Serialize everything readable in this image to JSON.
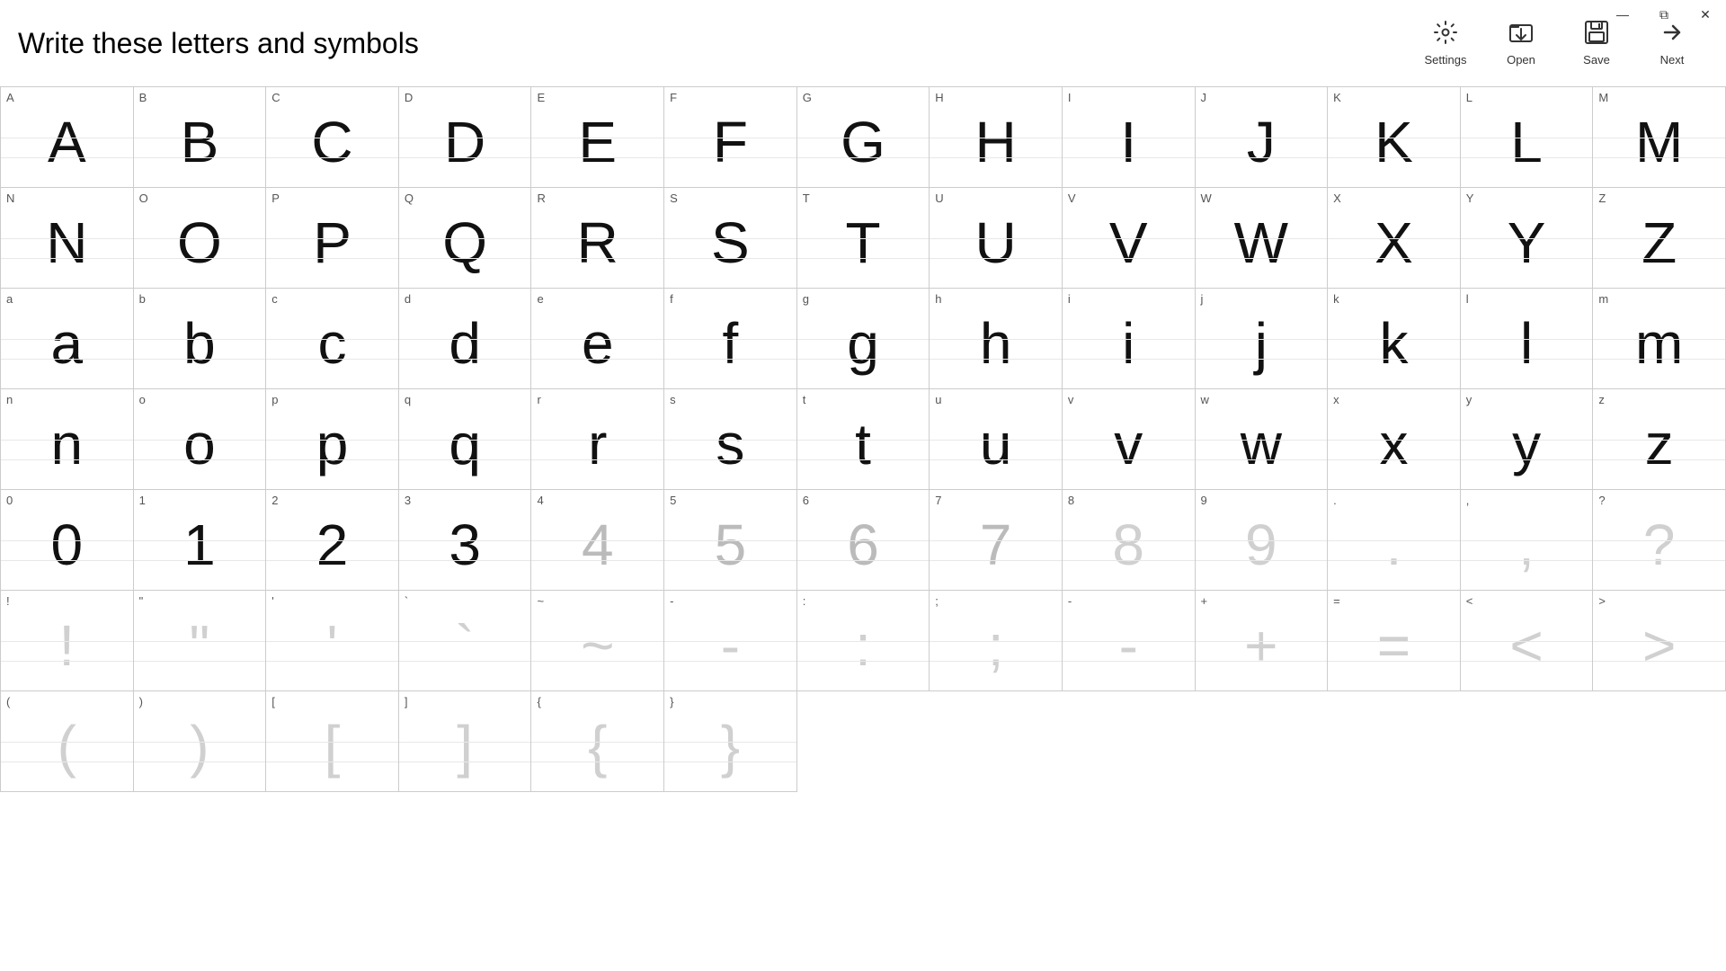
{
  "title": "Write these letters and symbols",
  "toolbar": {
    "settings_label": "Settings",
    "open_label": "Open",
    "save_label": "Save",
    "next_label": "Next"
  },
  "titlebar": {
    "minimize": "—",
    "maximize": "❐",
    "close": "✕"
  },
  "cells": [
    {
      "label": "A",
      "char": "A",
      "style": "handwritten"
    },
    {
      "label": "B",
      "char": "B",
      "style": "handwritten"
    },
    {
      "label": "C",
      "char": "C",
      "style": "handwritten"
    },
    {
      "label": "D",
      "char": "D",
      "style": "handwritten"
    },
    {
      "label": "E",
      "char": "E",
      "style": "handwritten"
    },
    {
      "label": "F",
      "char": "F",
      "style": "handwritten"
    },
    {
      "label": "G",
      "char": "G",
      "style": "handwritten"
    },
    {
      "label": "H",
      "char": "H",
      "style": "handwritten"
    },
    {
      "label": "I",
      "char": "I",
      "style": "handwritten"
    },
    {
      "label": "J",
      "char": "J",
      "style": "handwritten"
    },
    {
      "label": "K",
      "char": "K",
      "style": "handwritten"
    },
    {
      "label": "L",
      "char": "L",
      "style": "handwritten"
    },
    {
      "label": "M",
      "char": "M",
      "style": "handwritten"
    },
    {
      "label": "N",
      "char": "N",
      "style": "handwritten"
    },
    {
      "label": "O",
      "char": "O",
      "style": "handwritten"
    },
    {
      "label": "P",
      "char": "P",
      "style": "handwritten"
    },
    {
      "label": "Q",
      "char": "Q",
      "style": "handwritten"
    },
    {
      "label": "R",
      "char": "R",
      "style": "handwritten"
    },
    {
      "label": "S",
      "char": "S",
      "style": "handwritten"
    },
    {
      "label": "T",
      "char": "T",
      "style": "handwritten"
    },
    {
      "label": "U",
      "char": "U",
      "style": "handwritten"
    },
    {
      "label": "V",
      "char": "V",
      "style": "handwritten"
    },
    {
      "label": "W",
      "char": "W",
      "style": "handwritten"
    },
    {
      "label": "X",
      "char": "X",
      "style": "handwritten"
    },
    {
      "label": "Y",
      "char": "Y",
      "style": "handwritten"
    },
    {
      "label": "Z",
      "char": "Z",
      "style": "handwritten"
    },
    {
      "label": "a",
      "char": "a",
      "style": "handwritten"
    },
    {
      "label": "b",
      "char": "b",
      "style": "handwritten"
    },
    {
      "label": "c",
      "char": "c",
      "style": "handwritten"
    },
    {
      "label": "d",
      "char": "d",
      "style": "handwritten"
    },
    {
      "label": "e",
      "char": "e",
      "style": "handwritten"
    },
    {
      "label": "f",
      "char": "f",
      "style": "handwritten"
    },
    {
      "label": "g",
      "char": "g",
      "style": "handwritten"
    },
    {
      "label": "h",
      "char": "h",
      "style": "handwritten"
    },
    {
      "label": "i",
      "char": "i",
      "style": "handwritten"
    },
    {
      "label": "j",
      "char": "j",
      "style": "handwritten"
    },
    {
      "label": "k",
      "char": "k",
      "style": "handwritten"
    },
    {
      "label": "l",
      "char": "l",
      "style": "handwritten"
    },
    {
      "label": "m",
      "char": "m",
      "style": "handwritten"
    },
    {
      "label": "n",
      "char": "n",
      "style": "handwritten"
    },
    {
      "label": "o",
      "char": "o",
      "style": "handwritten"
    },
    {
      "label": "p",
      "char": "p",
      "style": "handwritten"
    },
    {
      "label": "q",
      "char": "q",
      "style": "handwritten"
    },
    {
      "label": "r",
      "char": "r",
      "style": "handwritten"
    },
    {
      "label": "s",
      "char": "s",
      "style": "handwritten"
    },
    {
      "label": "t",
      "char": "t",
      "style": "handwritten"
    },
    {
      "label": "u",
      "char": "u",
      "style": "handwritten"
    },
    {
      "label": "v",
      "char": "v",
      "style": "handwritten"
    },
    {
      "label": "w",
      "char": "w",
      "style": "handwritten"
    },
    {
      "label": "x",
      "char": "x",
      "style": "handwritten"
    },
    {
      "label": "y",
      "char": "y",
      "style": "handwritten"
    },
    {
      "label": "z",
      "char": "z",
      "style": "handwritten"
    },
    {
      "label": "0",
      "char": "0",
      "style": "handwritten"
    },
    {
      "label": "1",
      "char": "1",
      "style": "handwritten"
    },
    {
      "label": "2",
      "char": "2",
      "style": "handwritten"
    },
    {
      "label": "3",
      "char": "3",
      "style": "handwritten"
    },
    {
      "label": "4",
      "char": "4",
      "style": "grey"
    },
    {
      "label": "5",
      "char": "5",
      "style": "grey"
    },
    {
      "label": "6",
      "char": "6",
      "style": "grey"
    },
    {
      "label": "7",
      "char": "7",
      "style": "grey"
    },
    {
      "label": "8",
      "char": "8",
      "style": "light-grey"
    },
    {
      "label": "9",
      "char": "9",
      "style": "light-grey"
    },
    {
      "label": ".",
      "char": ".",
      "style": "light-grey"
    },
    {
      "label": ",",
      "char": ",",
      "style": "light-grey"
    },
    {
      "label": "?",
      "char": "?",
      "style": "light-grey"
    },
    {
      "label": "!",
      "char": "!",
      "style": "light-grey"
    },
    {
      "label": "\"",
      "char": "\"",
      "style": "light-grey"
    },
    {
      "label": "'",
      "char": "'",
      "style": "light-grey"
    },
    {
      "label": "`",
      "char": "`",
      "style": "light-grey"
    },
    {
      "label": "~",
      "char": "~",
      "style": "light-grey"
    },
    {
      "label": "-",
      "char": "-",
      "style": "light-grey"
    },
    {
      "label": ":",
      "char": ":",
      "style": "light-grey"
    },
    {
      "label": ";",
      "char": ";",
      "style": "light-grey"
    },
    {
      "label": "-",
      "char": "-",
      "style": "light-grey"
    },
    {
      "label": "+",
      "char": "+",
      "style": "light-grey"
    },
    {
      "label": "=",
      "char": "=",
      "style": "light-grey"
    },
    {
      "label": "<",
      "char": "<",
      "style": "light-grey"
    },
    {
      "label": ">",
      "char": ">",
      "style": "light-grey"
    },
    {
      "label": "(",
      "char": "(",
      "style": "light-grey"
    },
    {
      "label": ")",
      "char": ")",
      "style": "light-grey"
    },
    {
      "label": "[",
      "char": "[",
      "style": "light-grey"
    },
    {
      "label": "]",
      "char": "]",
      "style": "light-grey"
    },
    {
      "label": "{",
      "char": "{",
      "style": "light-grey"
    },
    {
      "label": "}",
      "char": "}",
      "style": "light-grey"
    }
  ]
}
